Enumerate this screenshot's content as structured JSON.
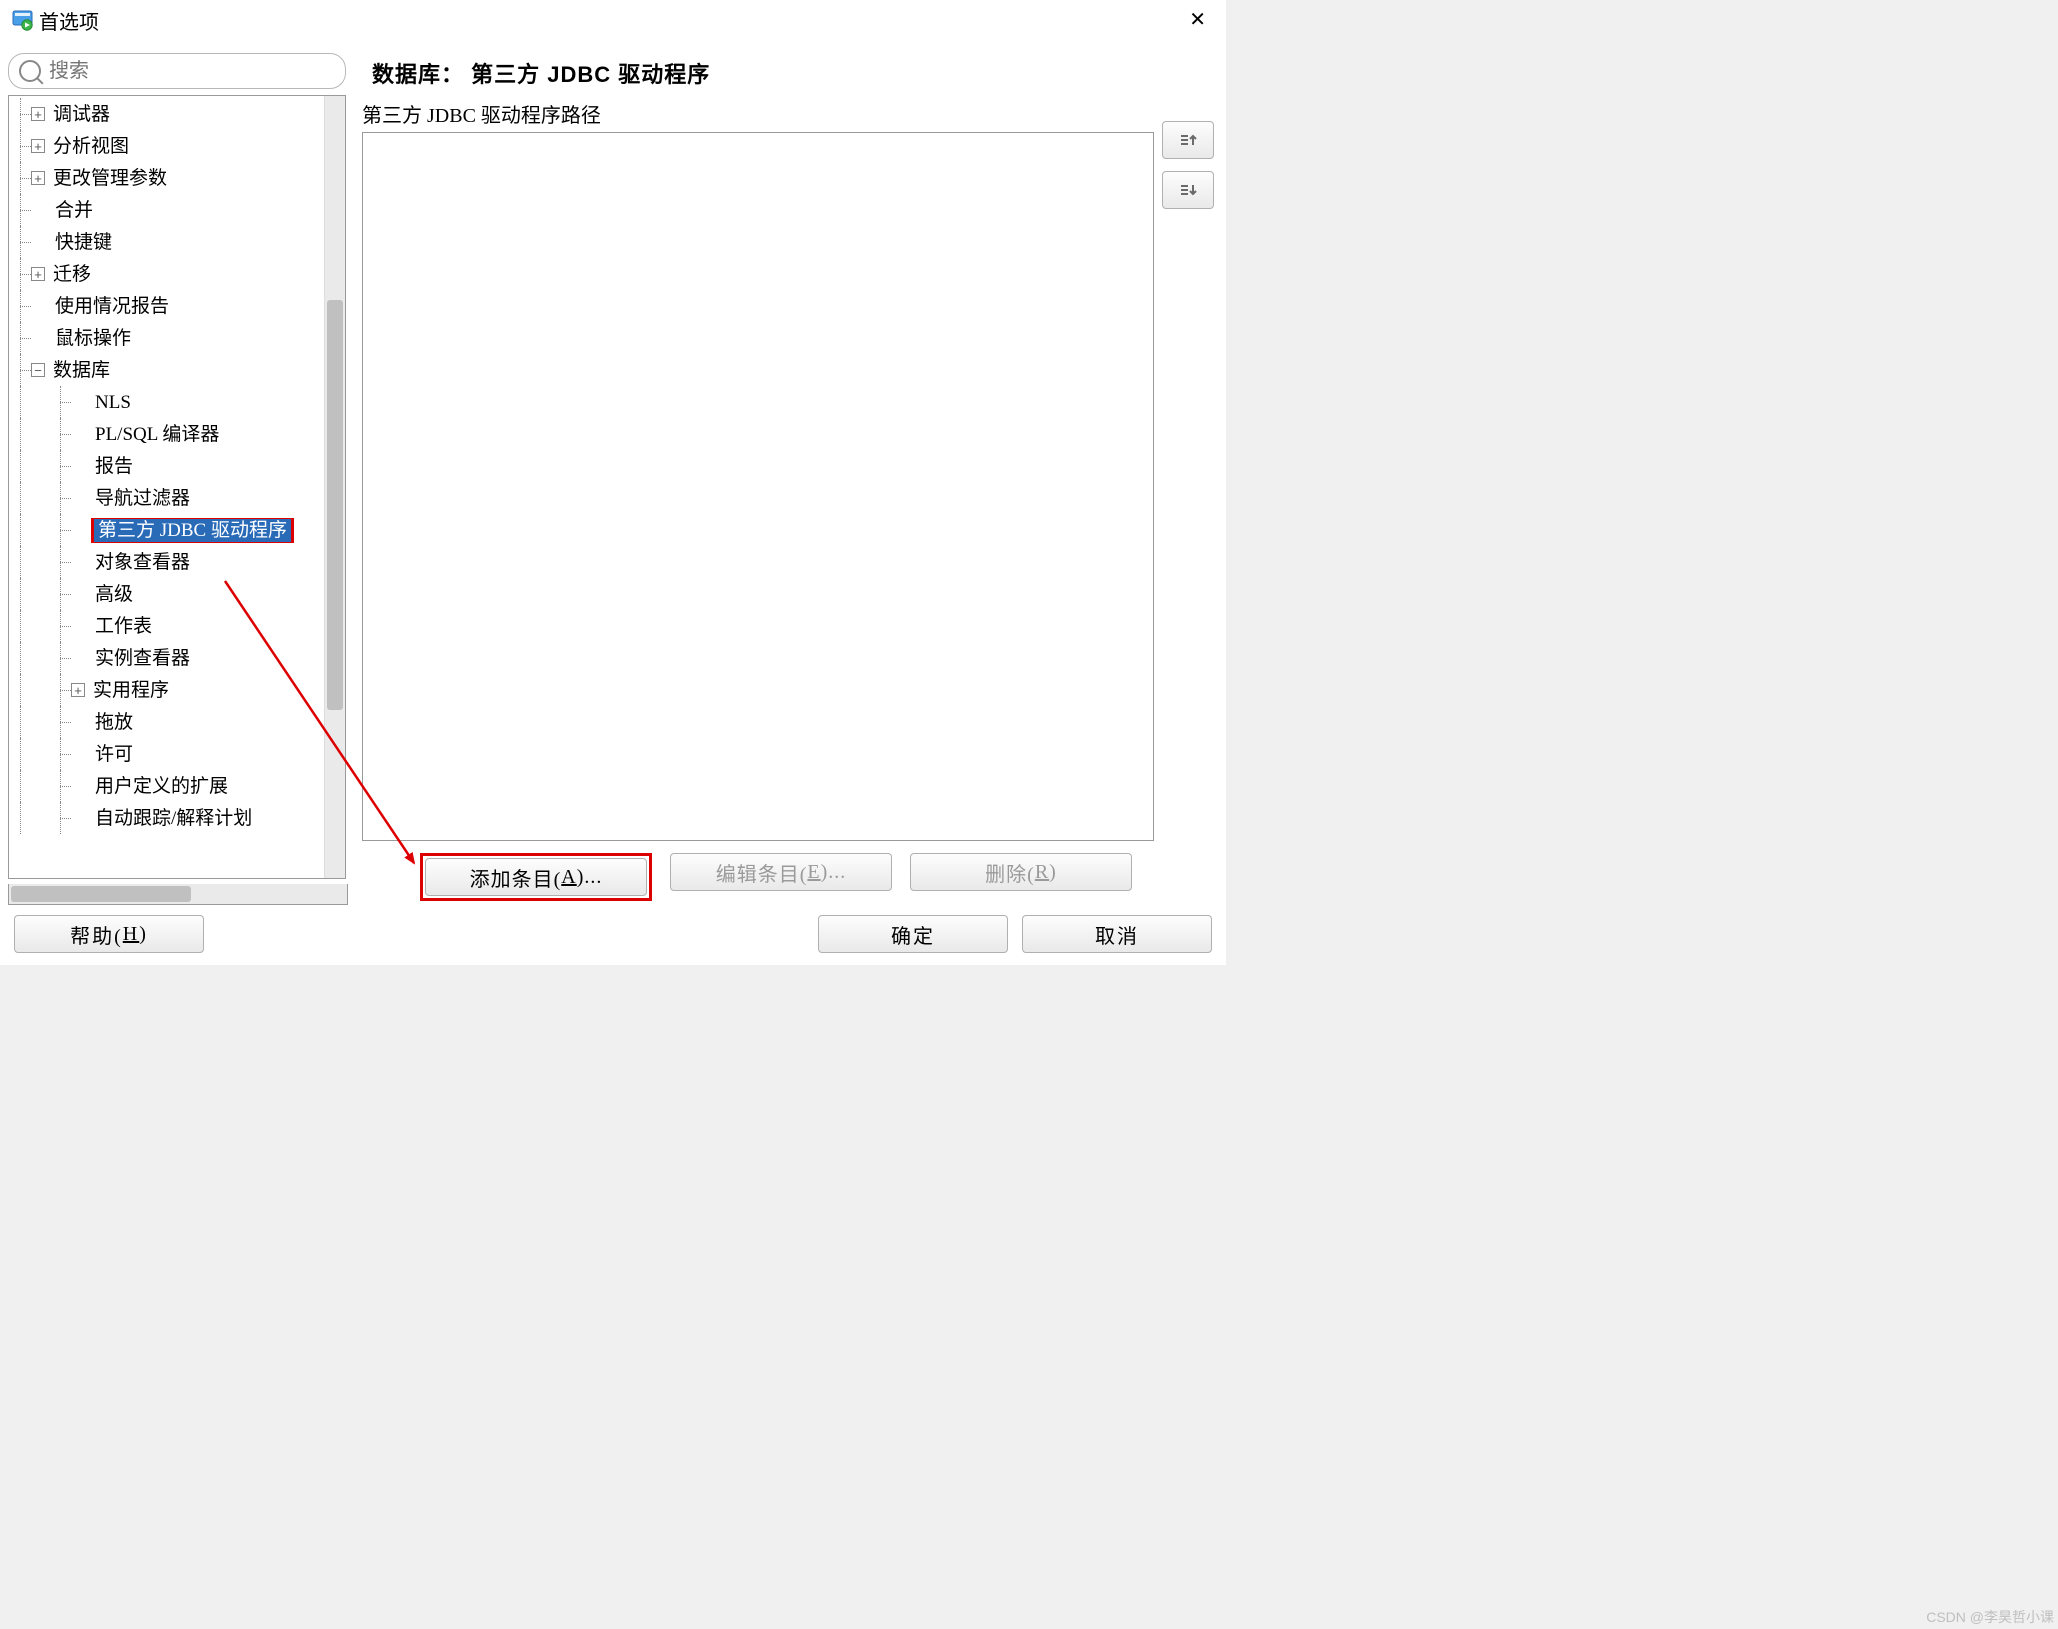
{
  "window": {
    "title": "首选项",
    "close_glyph": "✕"
  },
  "search": {
    "placeholder": "搜索"
  },
  "tree": {
    "items": [
      {
        "label": "调试器",
        "depth": 0,
        "icon": "plus"
      },
      {
        "label": "分析视图",
        "depth": 0,
        "icon": "plus"
      },
      {
        "label": "更改管理参数",
        "depth": 0,
        "icon": "plus"
      },
      {
        "label": "合并",
        "depth": 0,
        "icon": "leaf"
      },
      {
        "label": "快捷键",
        "depth": 0,
        "icon": "leaf"
      },
      {
        "label": "迁移",
        "depth": 0,
        "icon": "plus"
      },
      {
        "label": "使用情况报告",
        "depth": 0,
        "icon": "leaf"
      },
      {
        "label": "鼠标操作",
        "depth": 0,
        "icon": "leaf"
      },
      {
        "label": "数据库",
        "depth": 0,
        "icon": "minus"
      },
      {
        "label": "NLS",
        "depth": 1,
        "icon": "leaf"
      },
      {
        "label": "PL/SQL 编译器",
        "depth": 1,
        "icon": "leaf"
      },
      {
        "label": "报告",
        "depth": 1,
        "icon": "leaf"
      },
      {
        "label": "导航过滤器",
        "depth": 1,
        "icon": "leaf"
      },
      {
        "label": "第三方 JDBC 驱动程序",
        "depth": 1,
        "icon": "leaf",
        "selected": true
      },
      {
        "label": "对象查看器",
        "depth": 1,
        "icon": "leaf"
      },
      {
        "label": "高级",
        "depth": 1,
        "icon": "leaf"
      },
      {
        "label": "工作表",
        "depth": 1,
        "icon": "leaf"
      },
      {
        "label": "实例查看器",
        "depth": 1,
        "icon": "leaf"
      },
      {
        "label": "实用程序",
        "depth": 1,
        "icon": "plus"
      },
      {
        "label": "拖放",
        "depth": 1,
        "icon": "leaf"
      },
      {
        "label": "许可",
        "depth": 1,
        "icon": "leaf"
      },
      {
        "label": "用户定义的扩展",
        "depth": 1,
        "icon": "leaf"
      },
      {
        "label": "自动跟踪/解释计划",
        "depth": 1,
        "icon": "leaf"
      }
    ]
  },
  "right": {
    "title": "数据库： 第三方  JDBC  驱动程序",
    "list_label": "第三方 JDBC 驱动程序路径",
    "add_label_pre": "添加条目(",
    "add_key": "A",
    "add_label_post": ")...",
    "edit_label_pre": "编辑条目(",
    "edit_key": "E",
    "edit_label_post": ")...",
    "del_label_pre": "删除(",
    "del_key": "R",
    "del_label_post": ")"
  },
  "dialog": {
    "help_pre": "帮助(",
    "help_key": "H",
    "help_post": ")",
    "ok": "确定",
    "cancel": "取消"
  },
  "watermark": "CSDN @李昊哲小课"
}
